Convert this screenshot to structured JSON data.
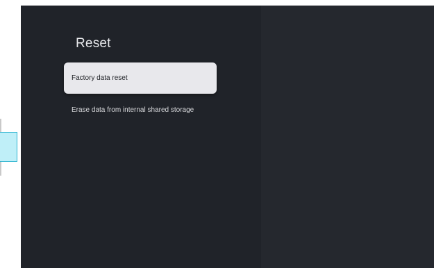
{
  "screen": {
    "title": "Reset",
    "items": [
      {
        "label": "Factory data reset",
        "focused": true
      },
      {
        "label": "Erase data from internal shared storage",
        "focused": false
      }
    ]
  },
  "colors": {
    "screen_background": "#1f2228",
    "panel_background": "#202329",
    "detail_background": "#25282e",
    "focused_item": "#e8e8ec",
    "edge_frame": "#bfeff8",
    "edge_frame_border": "#29b3cf"
  }
}
